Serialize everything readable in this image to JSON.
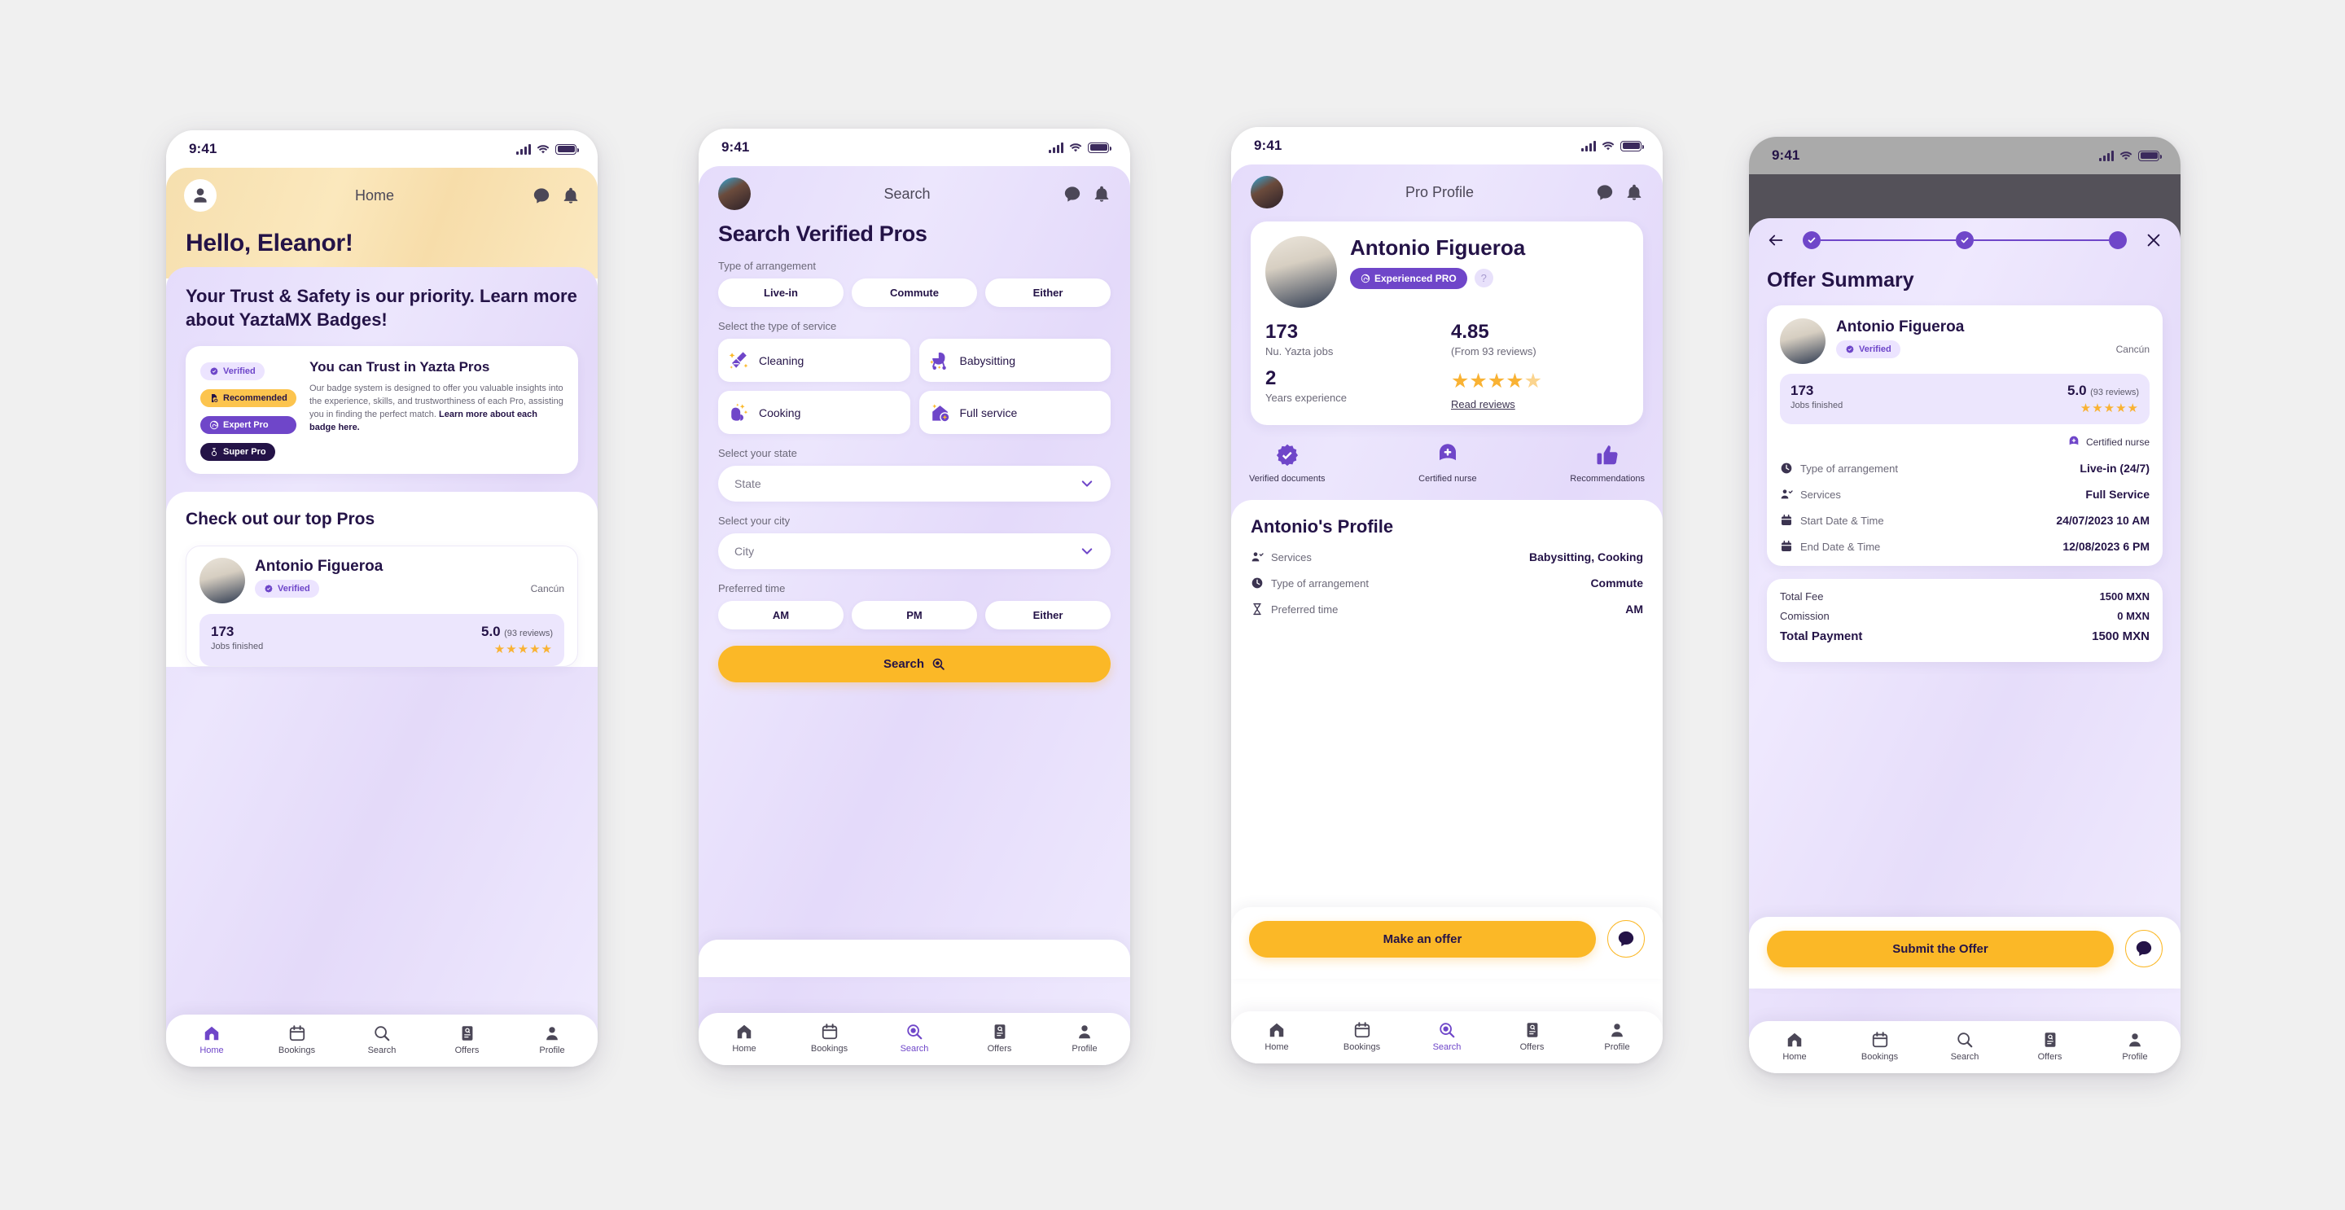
{
  "colors": {
    "purple": "#6f46c9",
    "dark": "#241347",
    "amber": "#fbb827",
    "lavender": "#ece6fd",
    "page_bg": "#f0f0f0"
  },
  "status_bar": {
    "time": "9:41"
  },
  "nav": {
    "items": [
      {
        "label": "Home",
        "icon": "home-icon"
      },
      {
        "label": "Bookings",
        "icon": "calendar-icon"
      },
      {
        "label": "Search",
        "icon": "search-icon"
      },
      {
        "label": "Offers",
        "icon": "offers-icon"
      },
      {
        "label": "Profile",
        "icon": "person-icon"
      }
    ]
  },
  "screen1": {
    "appbar": {
      "title": "Home",
      "avatar_icon": "person-avatar-icon",
      "chat_icon": "chat-icon",
      "bell_icon": "bell-icon"
    },
    "greeting": "Hello, Eleanor!",
    "promo_title": "Your Trust & Safety is our priority. Learn more about YaztaMX Badges!",
    "badges": [
      {
        "label": "Verified",
        "icon": "verified-badge-icon"
      },
      {
        "label": "Recommended",
        "icon": "recommended-badge-icon"
      },
      {
        "label": "Expert Pro",
        "icon": "expert-pro-badge-icon"
      },
      {
        "label": "Super Pro",
        "icon": "super-pro-badge-icon"
      }
    ],
    "badge_card": {
      "title": "You can Trust in Yazta Pros",
      "body": "Our badge system is designed to offer you valuable insights into the experience, skills, and trustworthiness of each Pro, assisting you in finding the perfect match. ",
      "body_link": "Learn more about each badge here."
    },
    "pros_section_title": "Check out our top Pros",
    "pro": {
      "name": "Antonio Figueroa",
      "verified_label": "Verified",
      "city": "Cancún",
      "jobs_number": "173",
      "jobs_label": "Jobs finished",
      "rating": "5.0",
      "reviews": "(93 reviews)",
      "stars": "★★★★★"
    },
    "active_nav": "Home"
  },
  "screen2": {
    "appbar": {
      "title": "Search",
      "chat_icon": "chat-icon",
      "bell_icon": "bell-icon"
    },
    "heading": "Search Verified Pros",
    "arrangement_label": "Type of arrangement",
    "arrangement_options": [
      "Live-in",
      "Commute",
      "Either"
    ],
    "service_label": "Select the type of service",
    "services": [
      {
        "label": "Cleaning",
        "icon": "broom-icon"
      },
      {
        "label": "Babysitting",
        "icon": "stroller-icon"
      },
      {
        "label": "Cooking",
        "icon": "cooking-glove-icon"
      },
      {
        "label": "Full service",
        "icon": "house-sparkle-icon"
      }
    ],
    "state_label": "Select your state",
    "state_placeholder": "State",
    "city_label": "Select your city",
    "city_placeholder": "City",
    "time_label": "Preferred time",
    "time_options": [
      "AM",
      "PM",
      "Either"
    ],
    "search_button": "Search",
    "active_nav": "Search"
  },
  "screen3": {
    "appbar": {
      "title": "Pro Profile",
      "chat_icon": "chat-icon",
      "bell_icon": "bell-icon"
    },
    "pro": {
      "name": "Antonio Figueroa",
      "badge": "Experienced PRO",
      "help_icon": "help-icon",
      "jobs_number": "173",
      "jobs_label": "Nu. Yazta jobs",
      "rating": "4.85",
      "reviews_label": "(From 93 reviews)",
      "stars": "★★★★",
      "half_star": "★",
      "years_number": "2",
      "years_label": "Years experience",
      "read_reviews": "Read reviews"
    },
    "badges": [
      {
        "label": "Verified documents",
        "icon": "verified-seal-icon"
      },
      {
        "label": "Certified nurse",
        "icon": "nurse-cap-icon"
      },
      {
        "label": "Recommendations",
        "icon": "thumbs-up-icon"
      }
    ],
    "sheet_title": "Antonio's Profile",
    "details": [
      {
        "icon": "services-icon",
        "label": "Services",
        "value": "Babysitting, Cooking"
      },
      {
        "icon": "clock-icon",
        "label": "Type of arrangement",
        "value": "Commute"
      },
      {
        "icon": "hourglass-icon",
        "label": "Preferred time",
        "value": "AM"
      }
    ],
    "cta": "Make an offer",
    "chat_fab_icon": "chat-fab-icon",
    "active_nav": "Search"
  },
  "screen4": {
    "back_icon": "back-arrow-icon",
    "close_icon": "close-icon",
    "steps": [
      "done",
      "done",
      "current"
    ],
    "title": "Offer Summary",
    "pro": {
      "name": "Antonio Figueroa",
      "verified_label": "Verified",
      "city": "Cancún",
      "jobs_number": "173",
      "jobs_label": "Jobs finished",
      "rating": "5.0",
      "reviews": "(93 reviews)",
      "stars": "★★★★★",
      "nurse_label": "Certified nurse"
    },
    "details": [
      {
        "icon": "clock-icon",
        "label": "Type of arrangement",
        "value": "Live-in (24/7)"
      },
      {
        "icon": "services-icon",
        "label": "Services",
        "value": "Full Service"
      },
      {
        "icon": "calendar-icon",
        "label": "Start Date & Time",
        "value": "24/07/2023 10 AM"
      },
      {
        "icon": "calendar-icon",
        "label": "End Date & Time",
        "value": "12/08/2023 6 PM"
      }
    ],
    "totals": [
      {
        "label": "Total Fee",
        "value": "1500 MXN",
        "grand": false
      },
      {
        "label": "Comission",
        "value": "0 MXN",
        "grand": false
      },
      {
        "label": "Total Payment",
        "value": "1500 MXN",
        "grand": true
      }
    ],
    "cta": "Submit the Offer",
    "chat_fab_icon": "chat-fab-icon",
    "active_nav": "Search"
  }
}
